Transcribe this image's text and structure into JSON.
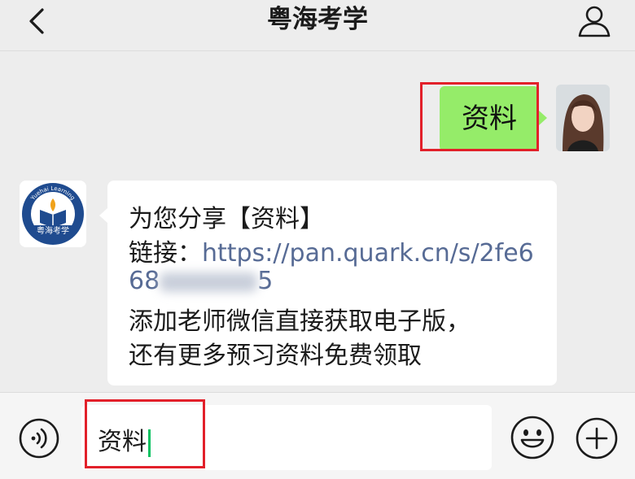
{
  "header": {
    "title": "粤海考学",
    "back_icon": "chevron-left-icon",
    "profile_icon": "person-icon"
  },
  "messages": {
    "outgoing": {
      "text": "资料",
      "bubble_color": "#95ec69"
    },
    "incoming": {
      "sender_logo_text": "粤海考学",
      "sender_logo_arc": "Yuehai Learning",
      "line1": "为您分享【资料】",
      "line2_prefix": "链接：",
      "line2_link": "https://pan.quark.cn/s/2fe6",
      "line3_start": "68",
      "line3_end": "5",
      "line4": "添加老师微信直接获取电子版，",
      "line5": "还有更多预习资料免费领取"
    }
  },
  "input_bar": {
    "value": "资料",
    "voice_icon": "voice-icon",
    "emoji_icon": "emoji-icon",
    "more_icon": "plus-circle-icon"
  },
  "colors": {
    "highlight": "#e2202a",
    "link": "#576b95",
    "caret": "#07c160"
  }
}
